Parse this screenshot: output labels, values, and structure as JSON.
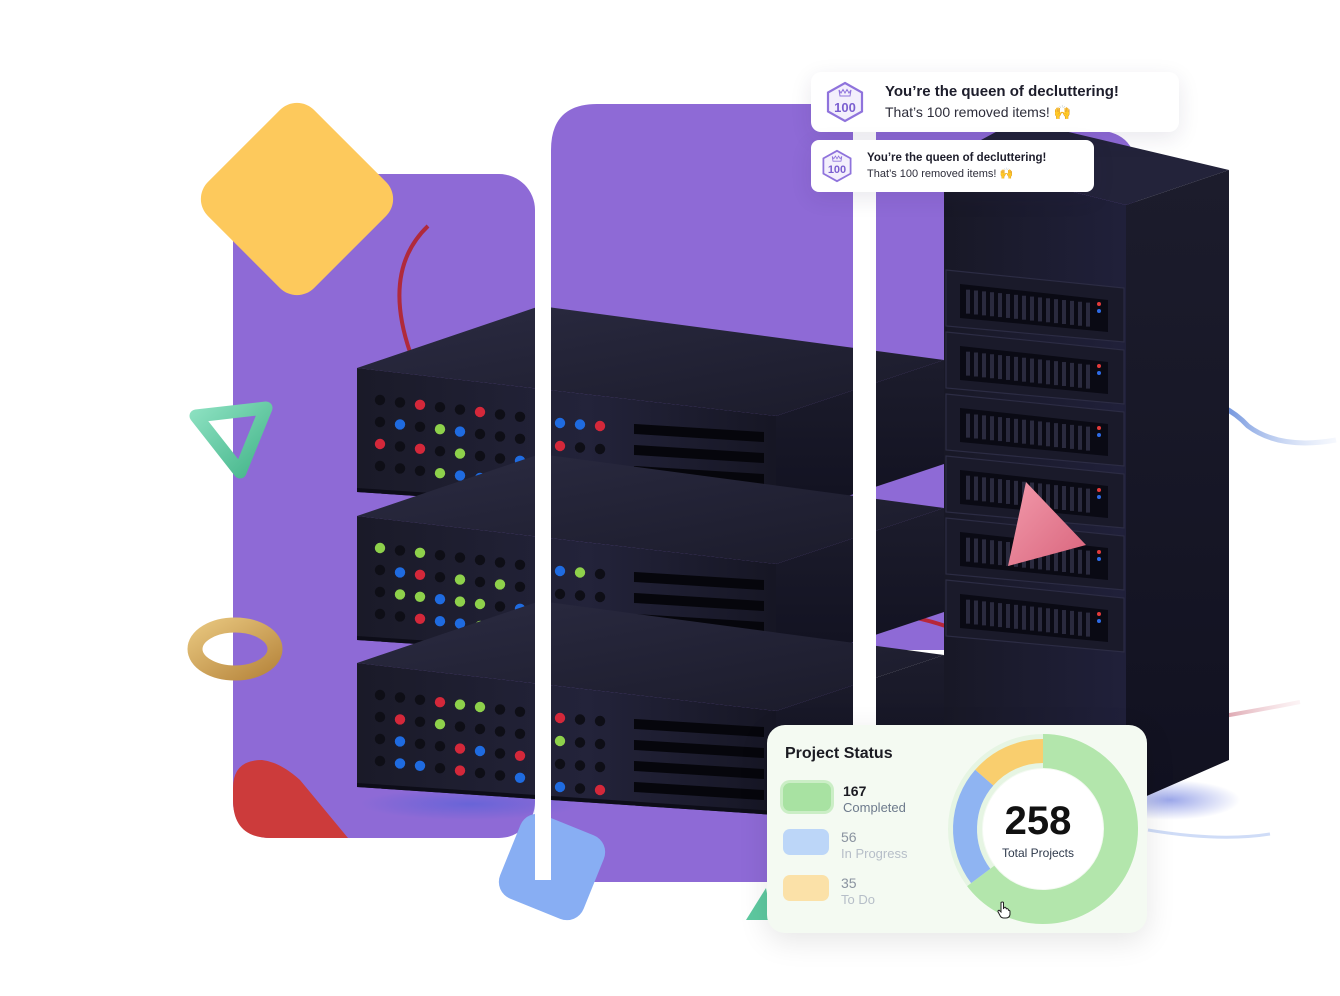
{
  "achievement_toasts": [
    {
      "badge": "100",
      "title": "You’re the queen of decluttering!",
      "body": "That’s 100 removed items!",
      "emoji": "🙌"
    },
    {
      "badge": "100",
      "title": "You’re the queen of decluttering!",
      "body": "That’s 100 removed items!",
      "emoji": "🙌"
    }
  ],
  "project_status": {
    "title": "Project Status",
    "items": [
      {
        "value": "167",
        "label": "Completed",
        "color": "#a8e2a2"
      },
      {
        "value": "56",
        "label": "In Progress",
        "color": "#bcd6f8"
      },
      {
        "value": "35",
        "label": "To Do",
        "color": "#fbe1a8"
      }
    ],
    "total": "258",
    "total_label": "Total Projects",
    "ring_colors": {
      "completed": "#b3e6ac",
      "in_progress": "#8fb4f2",
      "to_do": "#f9ce6e"
    }
  },
  "colors": {
    "purple_panel": "#8e6ad6",
    "yellow_diamond": "#fdc95c",
    "blue_square": "#88aef3",
    "red_corner": "#cc3b3b",
    "green_triangle": "#5ec9a0",
    "pink_triangle": "#e67a90",
    "gold_ring": "#cfa85c",
    "server_body": "#1e1e30"
  }
}
